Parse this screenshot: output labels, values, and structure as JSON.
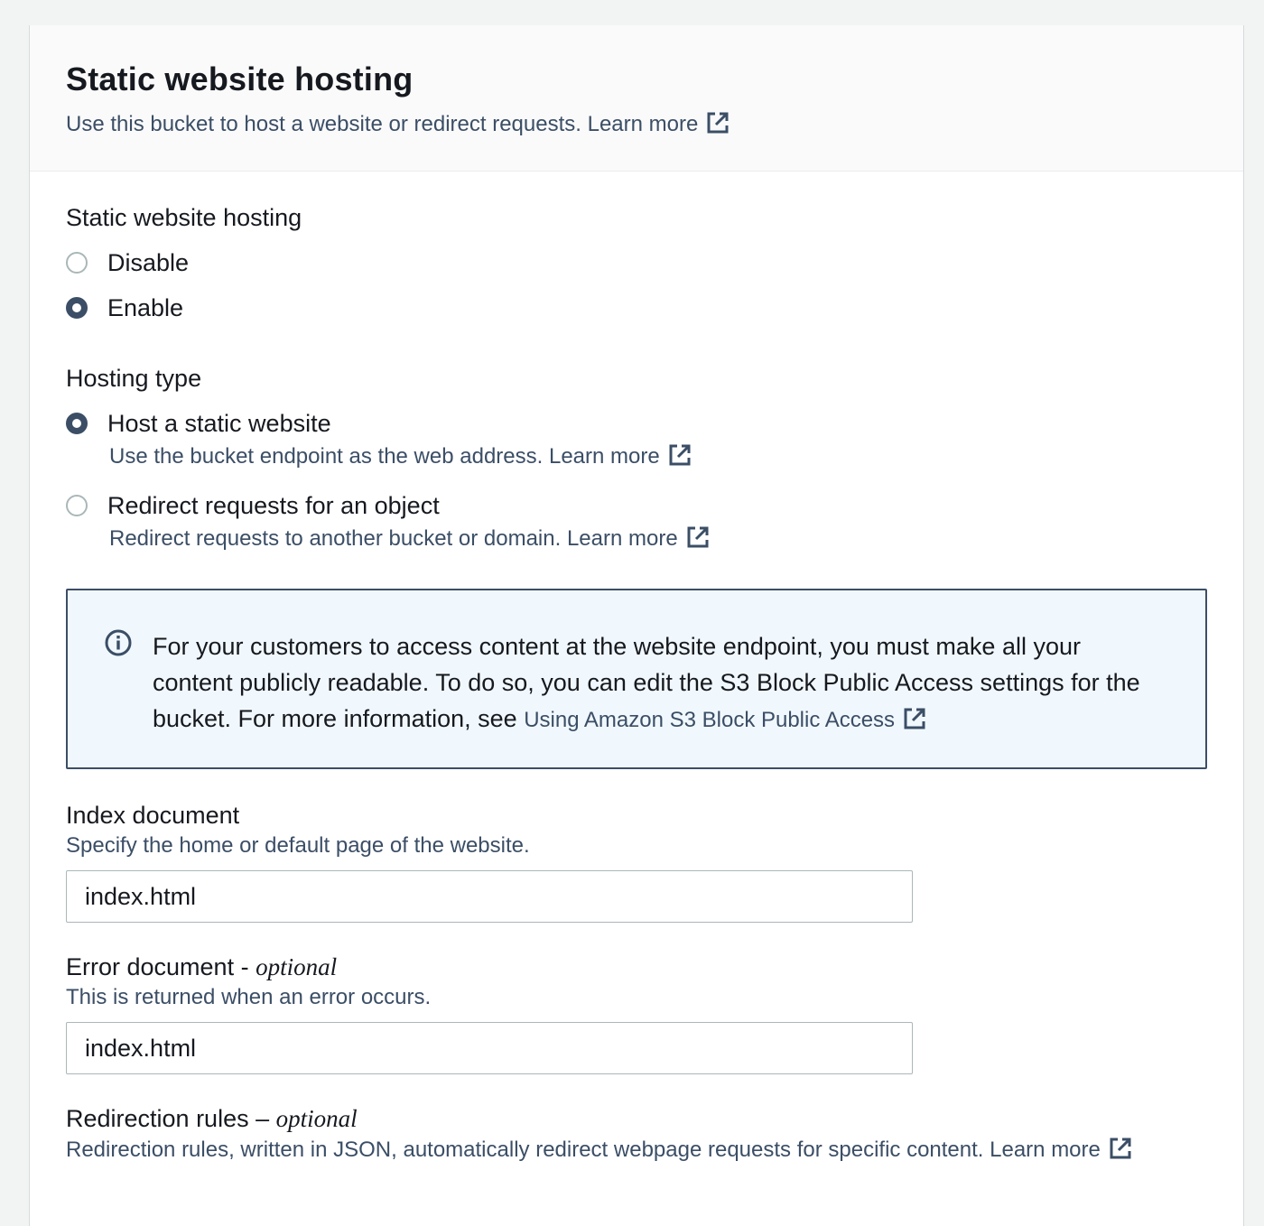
{
  "header": {
    "title": "Static website hosting",
    "description": "Use this bucket to host a website or redirect requests.",
    "learn_more": "Learn more"
  },
  "hosting_toggle": {
    "label": "Static website hosting",
    "options": [
      {
        "label": "Disable",
        "checked": false
      },
      {
        "label": "Enable",
        "checked": true
      }
    ]
  },
  "hosting_type": {
    "label": "Hosting type",
    "options": [
      {
        "label": "Host a static website",
        "description": "Use the bucket endpoint as the web address.",
        "learn_more": "Learn more",
        "checked": true
      },
      {
        "label": "Redirect requests for an object",
        "description": "Redirect requests to another bucket or domain.",
        "learn_more": "Learn more",
        "checked": false
      }
    ]
  },
  "info_alert": {
    "text": "For your customers to access content at the website endpoint, you must make all your content publicly readable. To do so, you can edit the S3 Block Public Access settings for the bucket. For more information, see",
    "link": "Using Amazon S3 Block Public Access"
  },
  "index_document": {
    "label": "Index document",
    "description": "Specify the home or default page of the website.",
    "value": "index.html"
  },
  "error_document": {
    "label": "Error document - ",
    "optional": "optional",
    "description": "This is returned when an error occurs.",
    "value": "index.html"
  },
  "redirection_rules": {
    "label": "Redirection rules – ",
    "optional": "optional",
    "description": "Redirection rules, written in JSON, automatically redirect webpage requests for specific content.",
    "learn_more": "Learn more"
  },
  "colors": {
    "link": "#3b4e66",
    "info_border": "#3b4e66",
    "info_bg": "#f1f8fd",
    "header_bg": "#fafafa"
  }
}
